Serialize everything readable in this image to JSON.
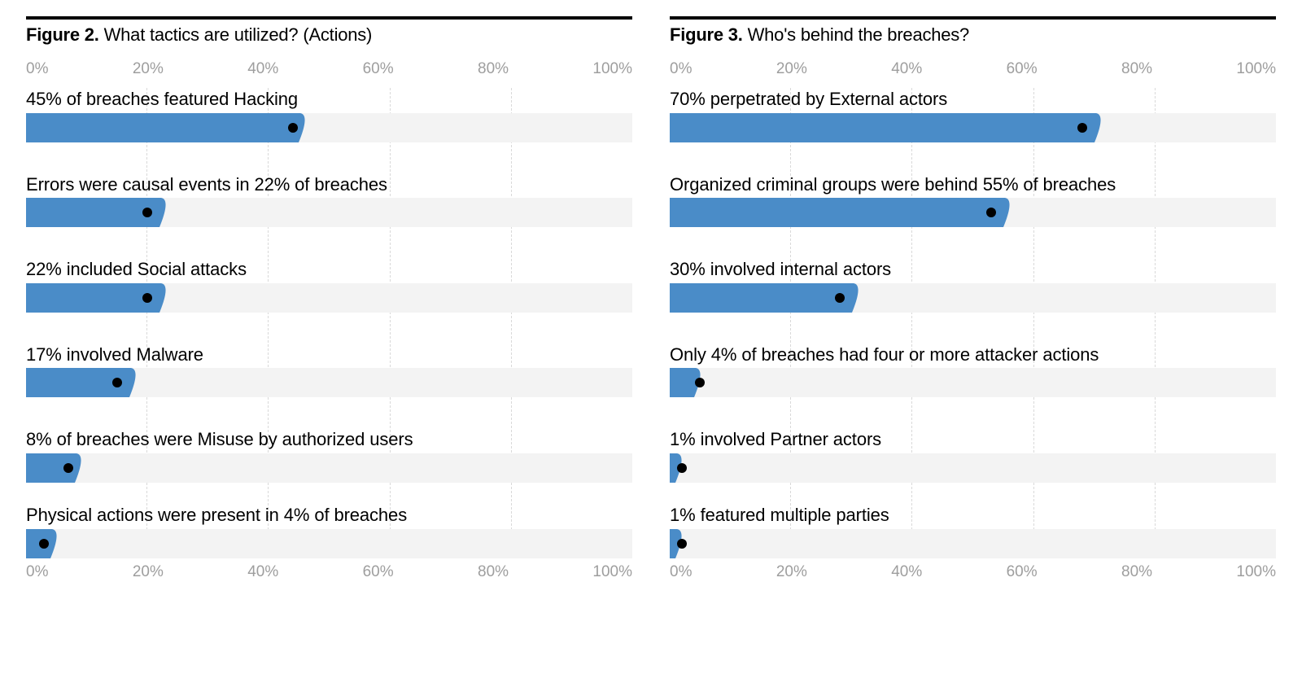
{
  "axis_ticks": [
    "0%",
    "20%",
    "40%",
    "60%",
    "80%",
    "100%"
  ],
  "chart_data": [
    {
      "type": "bar",
      "figure": "Figure 2.",
      "title": "What tactics are utilized? (Actions)",
      "xlim": [
        0,
        100
      ],
      "items": [
        {
          "label": "45% of breaches featured Hacking",
          "value": 45,
          "dot": 44
        },
        {
          "label": "Errors were causal events in 22% of breaches",
          "value": 22,
          "dot": 20
        },
        {
          "label": "22% included Social attacks",
          "value": 22,
          "dot": 20
        },
        {
          "label": "17% involved Malware",
          "value": 17,
          "dot": 15
        },
        {
          "label": "8% of breaches were Misuse by authorized users",
          "value": 8,
          "dot": 7
        },
        {
          "label": "Physical actions were present in 4% of breaches",
          "value": 4,
          "dot": 3
        }
      ]
    },
    {
      "type": "bar",
      "figure": "Figure 3.",
      "title": "Who's behind the breaches?",
      "xlim": [
        0,
        100
      ],
      "items": [
        {
          "label": "70% perpetrated by External actors",
          "value": 70,
          "dot": 68
        },
        {
          "label": "Organized criminal groups were behind 55% of breaches",
          "value": 55,
          "dot": 53
        },
        {
          "label": "30% involved internal actors",
          "value": 30,
          "dot": 28
        },
        {
          "label": "Only 4% of breaches had four or more attacker actions",
          "value": 4,
          "dot": 5
        },
        {
          "label": "1% involved Partner actors",
          "value": 1,
          "dot": 2
        },
        {
          "label": "1% featured multiple parties",
          "value": 1,
          "dot": 2
        }
      ]
    }
  ]
}
